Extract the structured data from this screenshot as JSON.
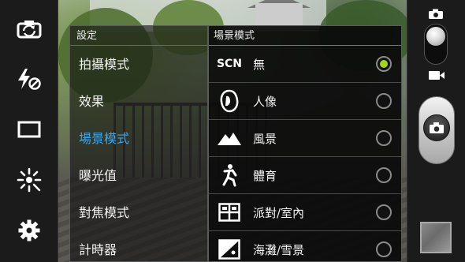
{
  "settings": {
    "title": "設定",
    "items": [
      {
        "label": "拍攝模式",
        "active": false
      },
      {
        "label": "效果",
        "active": false
      },
      {
        "label": "場景模式",
        "active": true
      },
      {
        "label": "曝光值",
        "active": false
      },
      {
        "label": "對焦模式",
        "active": false
      },
      {
        "label": "計時器",
        "active": false
      }
    ]
  },
  "scene_mode": {
    "title": "場景模式",
    "options": [
      {
        "label": "無",
        "icon": "scn-icon",
        "icon_text": "SCN",
        "selected": true
      },
      {
        "label": "人像",
        "icon": "portrait-icon",
        "selected": false
      },
      {
        "label": "風景",
        "icon": "landscape-icon",
        "selected": false
      },
      {
        "label": "體育",
        "icon": "sports-icon",
        "selected": false
      },
      {
        "label": "派對/室內",
        "icon": "party-indoor-icon",
        "selected": false
      },
      {
        "label": "海灘/雪景",
        "icon": "beach-snow-icon",
        "selected": false
      }
    ]
  },
  "left_toolbar": [
    "switch-camera-icon",
    "flash-off-icon",
    "aspect-ratio-icon",
    "brightness-icon",
    "settings-gear-icon"
  ],
  "right_toolbar": [
    "camera-mode-icon",
    "mode-toggle-switch",
    "video-mode-icon",
    "shutter-button",
    "gallery-thumbnail"
  ],
  "colors": {
    "accent_selected": "#3aa7f0",
    "radio_checked": "#a6d41a"
  }
}
